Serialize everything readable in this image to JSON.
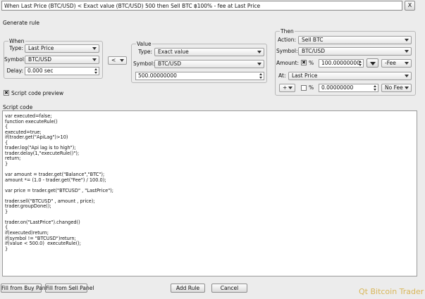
{
  "rule_title": "When Last Price (BTC/USD) < Exact value (BTC/USD) 500 then Sell BTC ฿100% - fee at Last Price",
  "close_label": "X",
  "generate_rule": {
    "label": "Generate rule",
    "when": {
      "label": "When",
      "type_label": "Type:",
      "type_value": "Last Price",
      "symbol_label": "Symbol:",
      "symbol_value": "BTC/USD",
      "delay_label": "Delay:",
      "delay_value": "0.000 sec"
    },
    "comparator": "<",
    "value": {
      "label": "Value",
      "type_label": "Type:",
      "type_value": "Exact value",
      "symbol_label": "Symbol:",
      "symbol_value": "BTC/USD",
      "amount_value": "500.00000000"
    },
    "then": {
      "label": "Then",
      "action_label": "Action:",
      "action_value": "Sell BTC",
      "symbol_label": "Symbol:",
      "symbol_value": "BTC/USD",
      "amount_label": "Amount:",
      "percent_check": "✖",
      "percent_label": "%",
      "amount_value": "100.00000000",
      "fee_value": "-Fee",
      "at_label": "At:",
      "at_value": "Last Price",
      "plus_label": "+",
      "offset_percent_label": "%",
      "offset_value": "0.00000000",
      "offset_fee_value": "No Fee"
    }
  },
  "script_preview": {
    "check": "✖",
    "label": "Script code preview"
  },
  "script_code": {
    "label": "Script code",
    "lines": [
      "var executed=false;",
      "function executeRule()",
      "{",
      "executed=true;",
      "if(trader.get(\"ApiLag\")>10)",
      "{",
      "trader.log(\"Api lag is to high\");",
      "trader.delay(1,\"executeRule()\");",
      "return;",
      "}",
      "",
      "var amount = trader.get(\"Balance\",\"BTC\");",
      "amount *= (1.0 - trader.get(\"Fee\") / 100.0);",
      "",
      "var price = trader.get(\"BTCUSD\" , \"LastPrice\");",
      "",
      "trader.sell(\"BTCUSD\" , amount , price);",
      "trader.groupDone();",
      "}",
      "",
      "trader.on(\"LastPrice\").changed()",
      "{",
      "if(executed)return;",
      "if(symbol != \"BTCUSD\")return;",
      "if(value < 500.0)  executeRule();",
      "}"
    ]
  },
  "footer": {
    "fill_buy": "Fill from Buy Panel",
    "fill_sell": "Fill from Sell Panel",
    "add_rule": "Add Rule",
    "cancel": "Cancel",
    "watermark": "Qt Bitcoin Trader"
  }
}
